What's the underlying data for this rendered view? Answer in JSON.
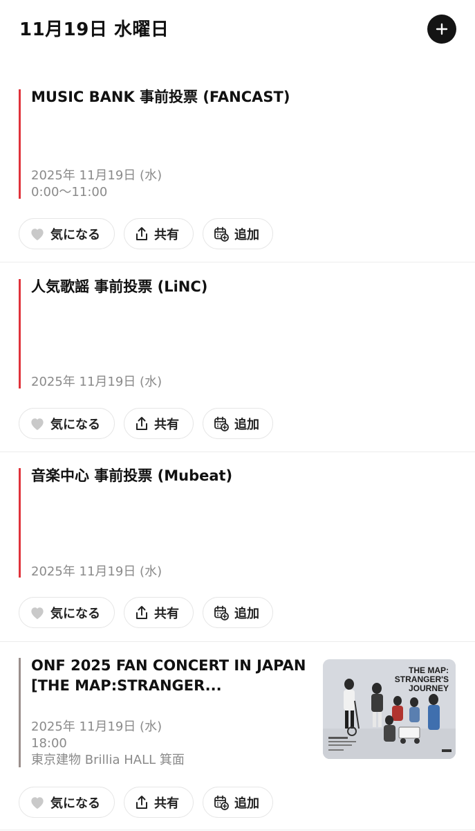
{
  "header": {
    "date_title": "11月19日 水曜日",
    "add_icon": "plus-icon"
  },
  "events": [
    {
      "title": "MUSIC BANK 事前投票 (FANCAST)",
      "date": "2025年 11月19日 (水)",
      "time": "0:00〜11:00",
      "accent_color": "#e0333b"
    },
    {
      "title": "人気歌謡 事前投票 (LiNC)",
      "date": "2025年 11月19日 (水)",
      "accent_color": "#e0333b"
    },
    {
      "title": "音楽中心 事前投票 (Mubeat)",
      "date": "2025年 11月19日 (水)",
      "accent_color": "#e0333b"
    },
    {
      "title": "ONF 2025 FAN CONCERT IN JAPAN [THE MAP:STRANGER...",
      "date": "2025年 11月19日 (水)",
      "time": "18:00",
      "venue": "東京建物 Brillia HALL 箕面",
      "accent_color": "#9a8f8c",
      "thumbnail_text": "THE MAP:\nSTRANGER'S\nJOURNEY"
    }
  ],
  "actions": {
    "like_label": "気になる",
    "share_label": "共有",
    "add_label": "追加",
    "like_icon": "heart-icon",
    "share_icon": "share-icon",
    "add_icon": "calendar-add-icon"
  }
}
